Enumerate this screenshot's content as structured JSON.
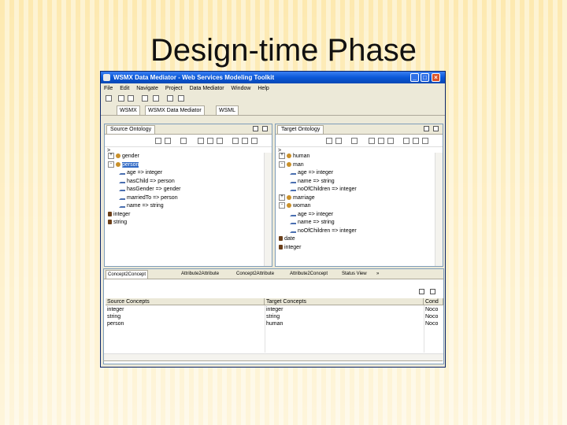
{
  "slide": {
    "title": "Design-time Phase"
  },
  "window": {
    "title": "WSMX Data Mediator - Web Services Modeling Toolkit",
    "menu": [
      "File",
      "Edit",
      "Navigate",
      "Project",
      "Data Mediator",
      "Window",
      "Help"
    ],
    "perspective_tabs": [
      "WSMX",
      "WSMX Data Mediator",
      "WSML"
    ],
    "left_pane": {
      "tab": "Source Ontology",
      "nodes": [
        {
          "label": "gender",
          "level": 0,
          "expander": "+",
          "icon": "concept"
        },
        {
          "label": "person",
          "level": 0,
          "expander": "-",
          "icon": "concept",
          "selected": true
        },
        {
          "label": "age => integer",
          "level": 1,
          "icon": "prop"
        },
        {
          "label": "hasChild => person",
          "level": 1,
          "icon": "prop"
        },
        {
          "label": "hasGender => gender",
          "level": 1,
          "icon": "prop"
        },
        {
          "label": "marriedTo => person",
          "level": 1,
          "icon": "prop"
        },
        {
          "label": "name => string",
          "level": 1,
          "icon": "prop"
        },
        {
          "label": "integer",
          "level": 0,
          "icon": "type"
        },
        {
          "label": "string",
          "level": 0,
          "icon": "type"
        }
      ]
    },
    "right_pane": {
      "tab": "Target Ontology",
      "nodes": [
        {
          "label": "human",
          "level": 0,
          "expander": "+",
          "icon": "concept"
        },
        {
          "label": "man",
          "level": 0,
          "expander": "-",
          "icon": "concept"
        },
        {
          "label": "age => integer",
          "level": 1,
          "icon": "prop"
        },
        {
          "label": "name => string",
          "level": 1,
          "icon": "prop"
        },
        {
          "label": "noOfChildren => integer",
          "level": 1,
          "icon": "prop"
        },
        {
          "label": "marriage",
          "level": 0,
          "expander": "+",
          "icon": "concept"
        },
        {
          "label": "woman",
          "level": 0,
          "expander": "-",
          "icon": "concept"
        },
        {
          "label": "age => integer",
          "level": 1,
          "icon": "prop"
        },
        {
          "label": "name => string",
          "level": 1,
          "icon": "prop"
        },
        {
          "label": "noOfChildren => integer",
          "level": 1,
          "icon": "prop"
        },
        {
          "label": "date",
          "level": 0,
          "icon": "type"
        },
        {
          "label": "integer",
          "level": 0,
          "icon": "type"
        }
      ]
    },
    "bottom_pane": {
      "tabs": [
        "Concept2Concept",
        "Attribute2Attribute",
        "Concept2Attribute",
        "Attribute2Concept",
        "Status View"
      ],
      "overflow": "»",
      "columns": [
        "Source Concepts",
        "Target Concepts",
        "Cond"
      ],
      "rows": [
        [
          "integer",
          "integer",
          "Noco"
        ],
        [
          "string",
          "string",
          "Noco"
        ],
        [
          "person",
          "human",
          "Noco"
        ]
      ]
    },
    "colors": {
      "titlebar": "#0a57d8",
      "selection": "#316ac5",
      "frame": "#ece9d8"
    }
  }
}
